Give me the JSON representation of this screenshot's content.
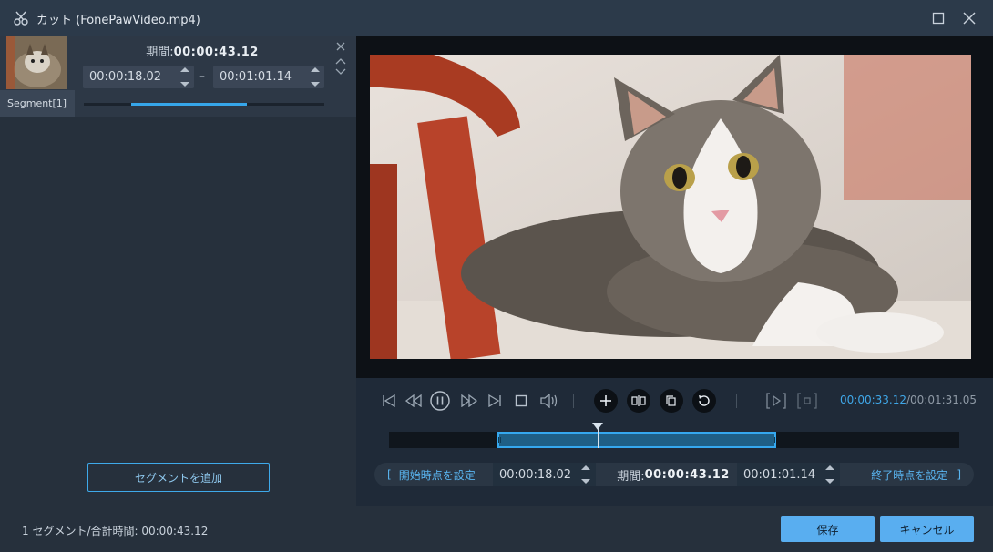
{
  "window": {
    "title": "カット (FonePawVideo.mp4)"
  },
  "segment_panel": {
    "duration_label": "期間:",
    "duration_value": "00:00:43.12",
    "start_time": "00:00:18.02",
    "end_time": "00:01:01.14",
    "separator": "–",
    "segment_name": "Segment[1]",
    "segment_progress": 0.48,
    "add_segment_label": "セグメントを追加"
  },
  "player": {
    "current_time": "00:00:33.12",
    "total_time": "/00:01:31.05"
  },
  "trim_bar": {
    "set_start_label": "開始時点を設定",
    "start_time": "00:00:18.02",
    "duration_label": "期間:",
    "duration_value": "00:00:43.12",
    "end_time": "00:01:01.14",
    "set_end_label": "終了時点を設定"
  },
  "footer": {
    "summary": "1 セグメント/合計時間: 00:00:43.12",
    "save_label": "保存",
    "cancel_label": "キャンセル"
  },
  "colors": {
    "accent": "#3ea9ea",
    "background": "#1f2a38"
  }
}
